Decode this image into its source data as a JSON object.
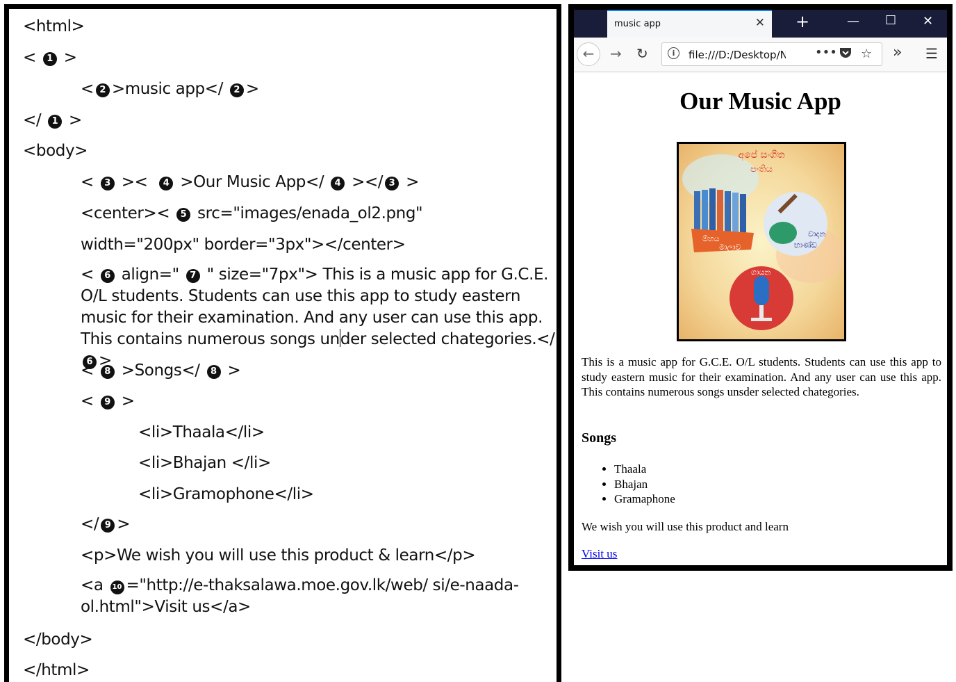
{
  "code": {
    "line1": "<html>",
    "b1": "1",
    "b2": "2",
    "b3": "3",
    "b4": "4",
    "b5": "5",
    "b6": "6",
    "b7": "7",
    "b8": "8",
    "b9": "9",
    "b10": "10",
    "music_app": "music app",
    "our_music_app": "Our Music App",
    "body_open": "<body>",
    "center_open": "<center><",
    "src_attr": "src=\"images/enada_ol2.png\"",
    "width_attr": "width=\"200px\" border=\"3px\"></center>",
    "align_attr": "align=\"",
    "size_attr": "\" size=\"7px\">",
    "para_text_a": "This is a music app for G.C.E. O/L students. Students can use this app to study eastern music for their examination. And any user can use this app. This contains numerous songs un",
    "para_text_b": "der selected chategories.</",
    "songs": "Songs",
    "li1": "<li>Thaala</li>",
    "li2": "<li>Bhajan </li>",
    "li3": "<li>Gramophone</li>",
    "p_line": "<p>We wish you will use this product & learn</p>",
    "a_open": "<a",
    "a_href_a": "=\"http://e-thaksalawa.moe.gov.lk/web/ si/e-naada-",
    "a_href_b": "ol.html\">Visit us</a>",
    "body_close": "</body>",
    "html_close": "</html>"
  },
  "browser": {
    "tab_title": "music app",
    "url": "file:///D:/Desktop/N",
    "heading": "Our Music App",
    "description": "This is a music app for G.C.E. O/L students. Students can use this app to study eastern music for their examination. And any user can use this app. This contains numerous songs unsder selected chategories.",
    "songs_heading": "Songs",
    "songs": [
      "Thaala",
      "Bhajan",
      "Gramaphone"
    ],
    "closing": "We wish you will use this product and learn",
    "link": "Visit us",
    "image_text": {
      "top_line1": "අපේ සංගීත",
      "top_line2": "පංතිය",
      "left_label_1": "ම්හය",
      "left_label_2": "මාලාව",
      "right_label_1": "වාදන",
      "right_label_2": "භාණ්ඩ",
      "bottom_label": "ගායන"
    }
  },
  "colors": {
    "tab_active_accent": "#0a84ff",
    "tabbar_bg": "#1a1d3a",
    "link": "#0000ee"
  }
}
